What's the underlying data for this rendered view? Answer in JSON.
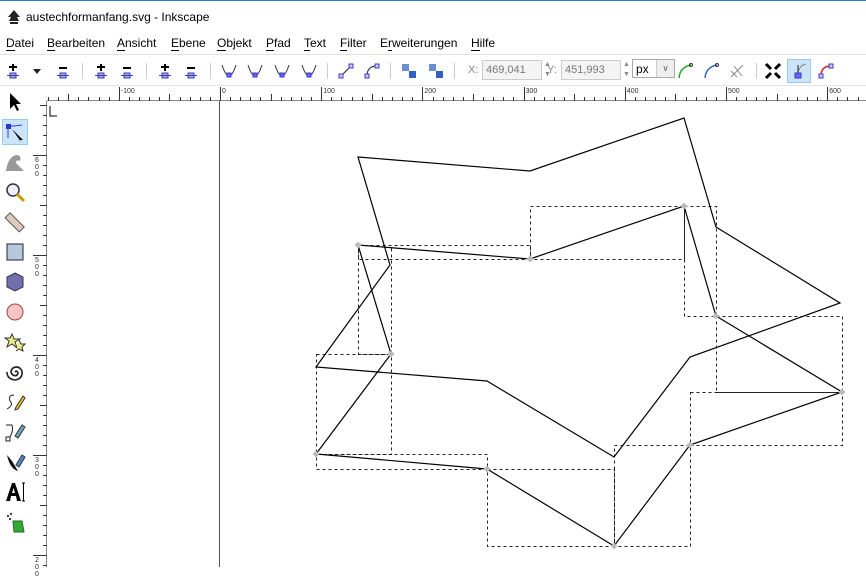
{
  "window": {
    "title": "austechformanfang.svg - Inkscape",
    "app_icon": "inkscape-logo-icon"
  },
  "menu": [
    {
      "label": "Datei",
      "key": "D"
    },
    {
      "label": "Bearbeiten",
      "key": "B"
    },
    {
      "label": "Ansicht",
      "key": "A"
    },
    {
      "label": "Ebene",
      "key": "E"
    },
    {
      "label": "Objekt",
      "key": "O"
    },
    {
      "label": "Pfad",
      "key": "P"
    },
    {
      "label": "Text",
      "key": "T"
    },
    {
      "label": "Filter",
      "key": "F"
    },
    {
      "label": "Erweiterungen",
      "key": "r"
    },
    {
      "label": "Hilfe",
      "key": "H"
    }
  ],
  "node_toolbar": {
    "x_label": "X:",
    "x_value": "469,041",
    "y_label": "Y:",
    "y_value": "451,993",
    "unit": "px",
    "buttons": [
      "insert-node",
      "insert-node-menu",
      "delete-node",
      "join-nodes",
      "break-path",
      "join-segment",
      "delete-segment",
      "cusp-node",
      "smooth-node",
      "symmetric-node",
      "auto-smooth-node",
      "make-line",
      "make-curve",
      "object-to-path",
      "stroke-to-path",
      "next-path-effect",
      "show-path-outline",
      "show-bbox",
      "show-transform-handles",
      "show-handles",
      "show-path-effect"
    ],
    "active": "show-handles"
  },
  "tools": [
    "selector",
    "node",
    "tweak",
    "zoom",
    "measure",
    "rect",
    "3dbox",
    "ellipse",
    "star",
    "spiral",
    "pencil",
    "pen",
    "calligraphy",
    "text",
    "spray"
  ],
  "active_tool": "node",
  "ruler": {
    "h_labels": [
      "-100",
      "0",
      "100",
      "200",
      "300",
      "400",
      "500",
      "600"
    ],
    "v_labels": [
      "600",
      "500",
      "400",
      "300",
      "200"
    ]
  },
  "colors": {
    "accent": "#cce4f7",
    "node": "#bbbbbb",
    "stroke": "#000000"
  }
}
